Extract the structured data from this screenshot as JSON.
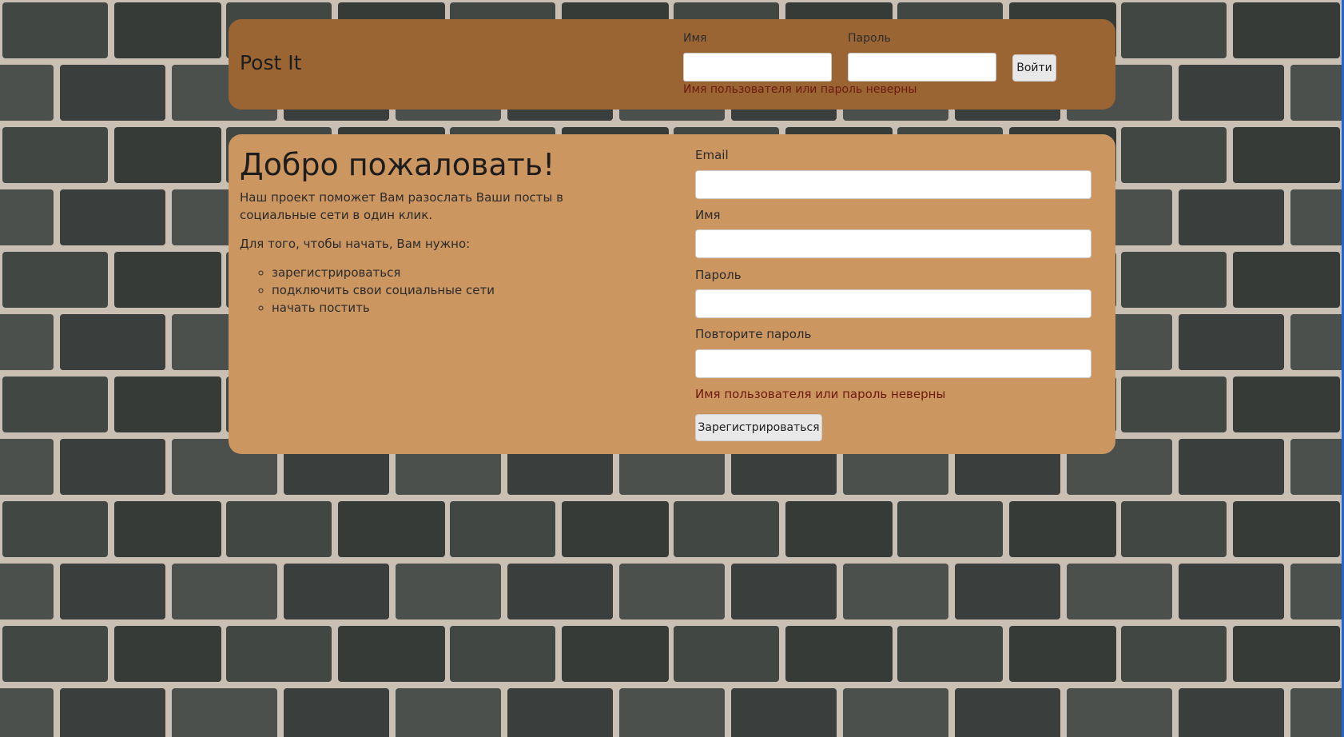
{
  "header": {
    "brand": "Post It",
    "username_label": "Имя",
    "password_label": "Пароль",
    "username_value": "",
    "password_value": "",
    "login_button": "Войти",
    "error": "Имя пользователя или пароль неверны"
  },
  "main": {
    "title": "Добро пожаловать!",
    "intro": "Наш проект поможет Вам разослать Ваши посты в социальные сети в один клик.",
    "steps_intro": "Для того, чтобы начать, Вам нужно:",
    "steps": [
      "зарегистрироваться",
      "подключить свои социальные сети",
      "начать постить"
    ]
  },
  "register": {
    "email_label": "Email",
    "name_label": "Имя",
    "password_label": "Пароль",
    "repeat_label": "Повторите пароль",
    "email_value": "",
    "name_value": "",
    "password_value": "",
    "repeat_value": "",
    "error": "Имя пользователя или пароль неверны",
    "submit_button": "Зарегистрироваться"
  },
  "colors": {
    "header_panel": "#9a6533",
    "main_panel": "#cc9661",
    "error_text": "#6b1a0a"
  },
  "background": "brick-wall-image"
}
